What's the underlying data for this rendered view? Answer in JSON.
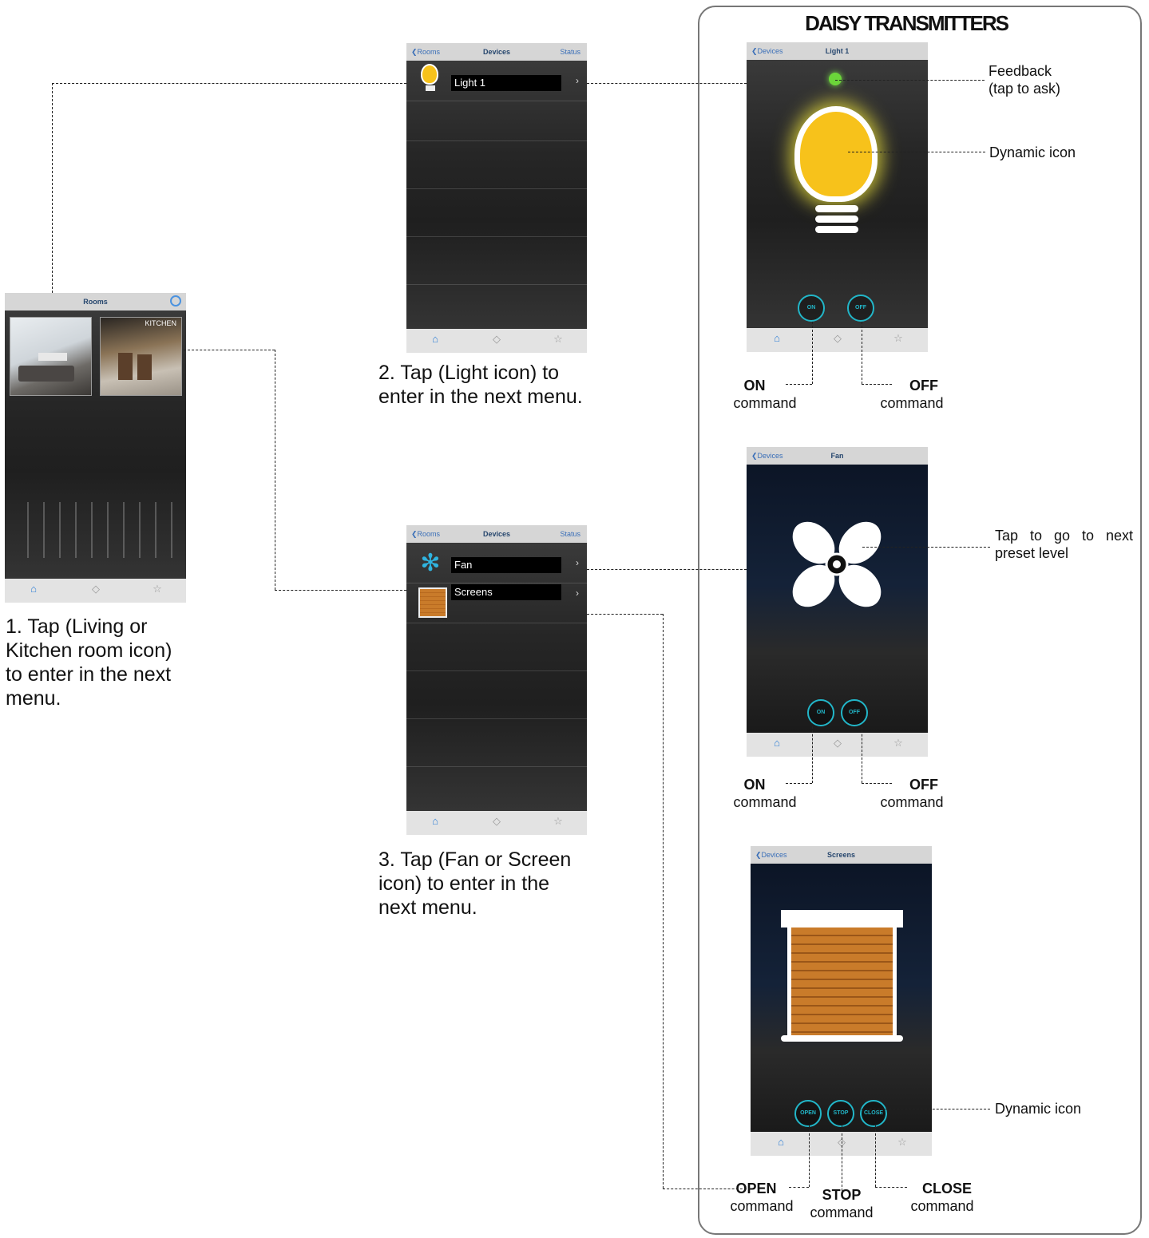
{
  "section_title": "DAISY TRANSMITTERS",
  "phone_rooms": {
    "nav_title": "Rooms",
    "room_label": "KITCHEN",
    "tab_labels": [
      "Home",
      "Scenes",
      "Favorites"
    ]
  },
  "phone_devices_a": {
    "nav_back": "Rooms",
    "nav_title": "Devices",
    "nav_right": "Status",
    "items": [
      {
        "label": "Light 1"
      }
    ]
  },
  "phone_devices_b": {
    "nav_back": "Rooms",
    "nav_title": "Devices",
    "nav_right": "Status",
    "items": [
      {
        "label": "Fan"
      },
      {
        "label": "Screens"
      }
    ]
  },
  "phone_light": {
    "nav_back": "Devices",
    "nav_title": "Light 1",
    "buttons": [
      "ON",
      "OFF"
    ]
  },
  "phone_fan": {
    "nav_back": "Devices",
    "nav_title": "Fan",
    "buttons": [
      "ON",
      "OFF"
    ]
  },
  "phone_screens": {
    "nav_back": "Devices",
    "nav_title": "Screens",
    "buttons": [
      "OPEN",
      "STOP",
      "CLOSE"
    ]
  },
  "captions": {
    "step1": [
      "1. Tap (Living or",
      "Kitchen room icon)",
      "to enter in the next",
      "menu."
    ],
    "step2": [
      "2. Tap (Light icon) to",
      "enter in the next menu."
    ],
    "step3": [
      "3. Tap (Fan or Screen",
      "icon) to enter in the",
      "next menu."
    ]
  },
  "annotations": {
    "feedback": [
      "Feedback",
      "(tap to ask)"
    ],
    "dynamic_icon": "Dynamic icon",
    "tap_next": [
      "Tap to go to next",
      "preset level"
    ],
    "on": "ON",
    "off": "OFF",
    "open": "OPEN",
    "stop": "STOP",
    "close": "CLOSE",
    "command": "command"
  },
  "colors": {
    "accent": "#22b6c8",
    "bulb": "#f7c21b",
    "wood": "#c97b2a"
  }
}
